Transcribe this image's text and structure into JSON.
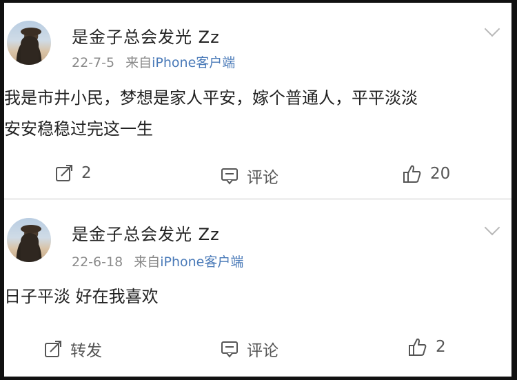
{
  "posts": [
    {
      "username": "是金子总会发光 Zz",
      "date": "22-7-5",
      "source_prefix": "来自",
      "source": "iPhone客户端",
      "text_line1": "我是市井小民，梦想是家人平安，嫁个普通人，平平淡淡",
      "text_line2": "安安稳稳过完这一生",
      "repost": "2",
      "comment": "评论",
      "like": "20"
    },
    {
      "username": "是金子总会发光 Zz",
      "date": "22-6-18",
      "source_prefix": "来自",
      "source": "iPhone客户端",
      "text_line1": "日子平淡 好在我喜欢",
      "repost": "转发",
      "comment": "评论",
      "like": "2"
    }
  ],
  "icons": {
    "repost": "share-edit-icon",
    "comment": "comment-bubble-icon",
    "like": "thumbs-up-icon",
    "more": "chevron-down-icon"
  }
}
